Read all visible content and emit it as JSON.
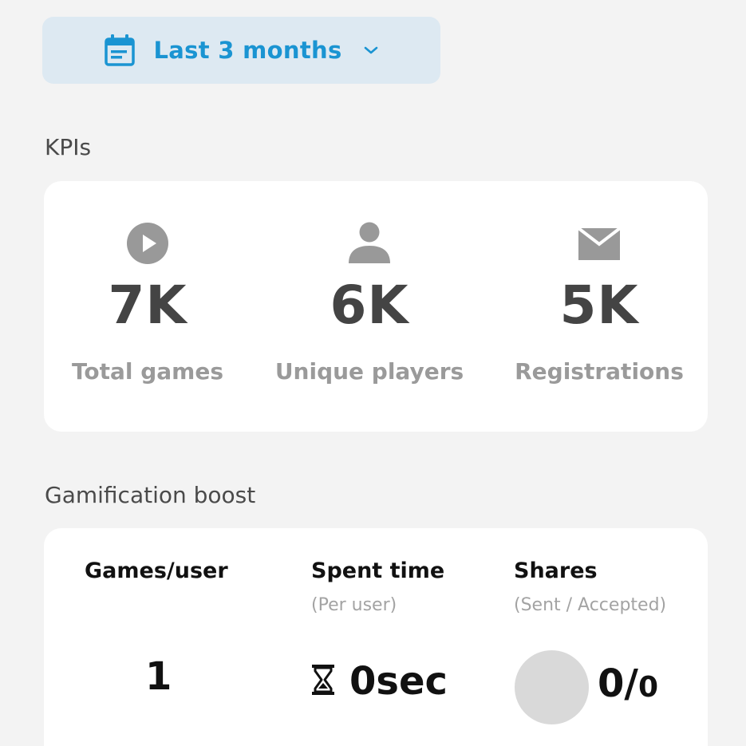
{
  "date_filter": {
    "label": "Last 3 months",
    "icon": "calendar-icon",
    "accent_color": "#1a94d2",
    "background_color": "#dde9f2"
  },
  "kpis": {
    "title": "KPIs",
    "items": [
      {
        "icon": "play-icon",
        "value": "7K",
        "label": "Total games"
      },
      {
        "icon": "user-icon",
        "value": "6K",
        "label": "Unique players"
      },
      {
        "icon": "envelope-icon",
        "value": "5K",
        "label": "Registrations"
      }
    ]
  },
  "gamification": {
    "title": "Gamification boost",
    "games_per_user": {
      "label": "Games/user",
      "value": "1"
    },
    "spent_time": {
      "label": "Spent time",
      "sublabel": "(Per user)",
      "icon": "hourglass-icon",
      "value": "0sec"
    },
    "shares": {
      "label": "Shares",
      "sublabel": "(Sent / Accepted)",
      "sent": "0",
      "separator": "/",
      "accepted": "0"
    }
  }
}
